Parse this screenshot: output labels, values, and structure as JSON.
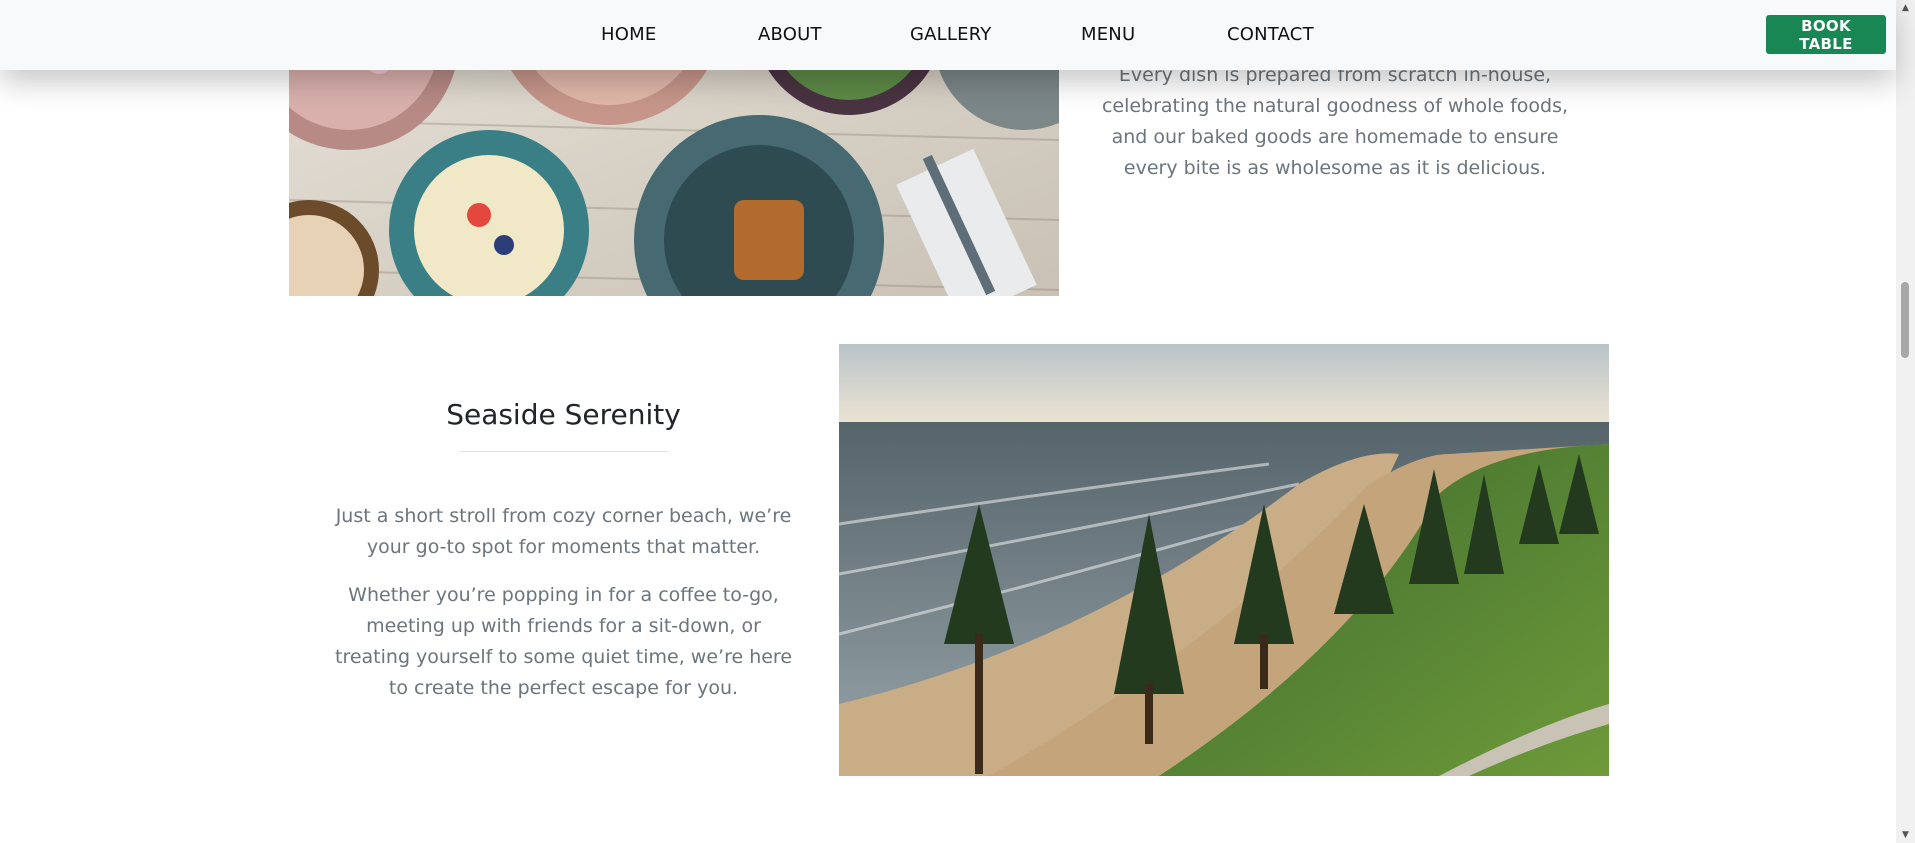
{
  "nav": {
    "home": "HOME",
    "about": "ABOUT",
    "gallery": "GALLERY",
    "menu": "MENU",
    "contact": "CONTACT",
    "book_button": "BOOK TABLE"
  },
  "food_section": {
    "lines": [
      "Every dish is prepared from scratch in-house,",
      "celebrating the natural goodness of whole foods,",
      "and our baked goods are homemade to ensure",
      "every bite is as wholesome as it is delicious."
    ]
  },
  "seaside": {
    "title": "Seaside Serenity",
    "paragraph_1": "Just a short stroll from cozy corner beach, we’re your go-to spot for moments that matter.",
    "paragraph_2": "Whether you’re popping in for a coffee to-go, meeting up with friends for a sit-down, or treating yourself to some quiet time, we’re here to create the perfect escape for you."
  },
  "colors": {
    "accent": "#198754",
    "navbar_bg": "#f8f9fa",
    "body_text": "#6c757d",
    "heading_text": "#212529"
  },
  "icons": {
    "scroll_up": "triangle-up-icon",
    "scroll_down": "triangle-down-icon"
  }
}
